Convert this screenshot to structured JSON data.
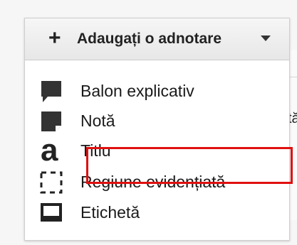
{
  "dropdown": {
    "add_icon": "+",
    "label": "Adaugați o adnotare",
    "caret_icon": "caret-down-icon"
  },
  "background": {
    "peek_text": "tă"
  },
  "menu": {
    "items": [
      {
        "label": "Balon explicativ",
        "icon": "speech-bubble-icon"
      },
      {
        "label": "Notă",
        "icon": "note-icon"
      },
      {
        "label": "Titlu",
        "icon": "title-text-icon"
      },
      {
        "label": "Regiune evidențiată",
        "icon": "highlight-region-icon"
      },
      {
        "label": "Etichetă",
        "icon": "label-icon"
      }
    ]
  },
  "annotation": {
    "highlight_color": "#e01010"
  }
}
